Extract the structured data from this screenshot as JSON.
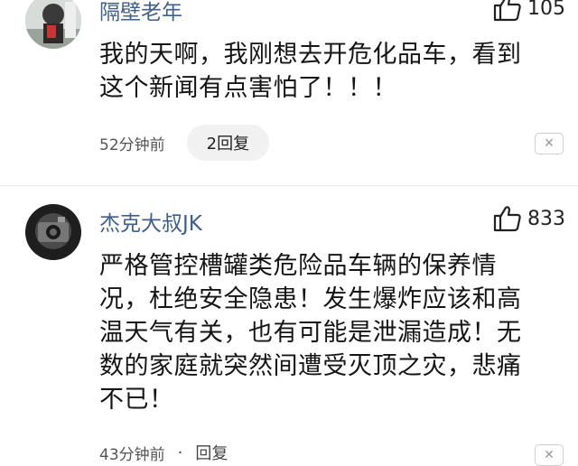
{
  "comments": [
    {
      "username": "隔壁老年",
      "like_icon": "thumb-up-icon",
      "like_count": "105",
      "text_lines": [
        "我的天啊，我刚想去开危化品车，看到",
        "这个新闻有点害怕了！！！"
      ],
      "time": "52分钟前",
      "reply_label": "2回复",
      "close_icon": "close-icon"
    },
    {
      "username": "杰克大叔JK",
      "like_icon": "thumb-up-icon",
      "like_count": "833",
      "text_lines": [
        "严格管控槽罐类危险品车辆的保养情",
        "况，杜绝安全隐患！发生爆炸应该和高",
        "温天气有关，也有可能是泄漏造成！无",
        "数的家庭就突然间遭受灭顶之灾，悲痛",
        "不已！"
      ],
      "time": "43分钟前",
      "reply_label": "回复",
      "close_icon": "close-icon"
    }
  ]
}
